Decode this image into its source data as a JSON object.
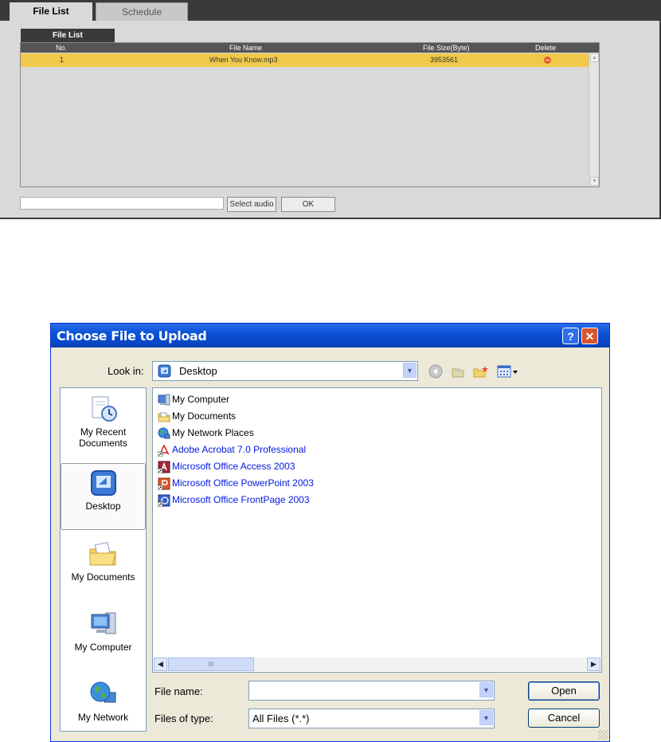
{
  "web": {
    "tabs": [
      {
        "label": "File List",
        "active": true
      },
      {
        "label": "Schedule",
        "active": false
      }
    ],
    "subtab": "File List",
    "columns": {
      "no": "No.",
      "name": "File Name",
      "size": "File Size(Byte)",
      "del": "Delete"
    },
    "rows": [
      {
        "no": "1",
        "name": "When You Know.mp3",
        "size": "3953561"
      }
    ],
    "file_path_value": "",
    "select_audio_label": "Select audio",
    "ok_label": "OK"
  },
  "dialog": {
    "title": "Choose File to Upload",
    "help_glyph": "?",
    "close_glyph": "✕",
    "look_in_label": "Look in:",
    "look_in_value": "Desktop",
    "places": [
      {
        "label": "My Recent Documents",
        "icon": "recent-documents-icon"
      },
      {
        "label": "Desktop",
        "icon": "desktop-icon"
      },
      {
        "label": "My Documents",
        "icon": "my-documents-icon"
      },
      {
        "label": "My Computer",
        "icon": "my-computer-icon"
      },
      {
        "label": "My Network",
        "icon": "network-globe-icon"
      }
    ],
    "files": [
      {
        "name": "My Computer",
        "icon": "computer-icon"
      },
      {
        "name": "My Documents",
        "icon": "folder-icon"
      },
      {
        "name": "My Network Places",
        "icon": "network-icon"
      },
      {
        "name": "Adobe Acrobat 7.0 Professional",
        "icon": "acrobat-shortcut-icon"
      },
      {
        "name": "Microsoft Office Access 2003",
        "icon": "access-shortcut-icon"
      },
      {
        "name": "Microsoft Office PowerPoint 2003",
        "icon": "powerpoint-shortcut-icon"
      },
      {
        "name": "Microsoft Office FrontPage 2003",
        "icon": "frontpage-shortcut-icon"
      }
    ],
    "file_name_label": "File name:",
    "file_name_value": "",
    "files_of_type_label": "Files of type:",
    "files_of_type_value": "All Files (*.*)",
    "open_label": "Open",
    "cancel_label": "Cancel",
    "scroll_thumb_glyph": "III"
  },
  "colors": {
    "row_highlight": "#f0c94a",
    "title_blue": "#0a52d6",
    "link_blue": "#0018e0",
    "delete_red": "#e85a2a"
  }
}
